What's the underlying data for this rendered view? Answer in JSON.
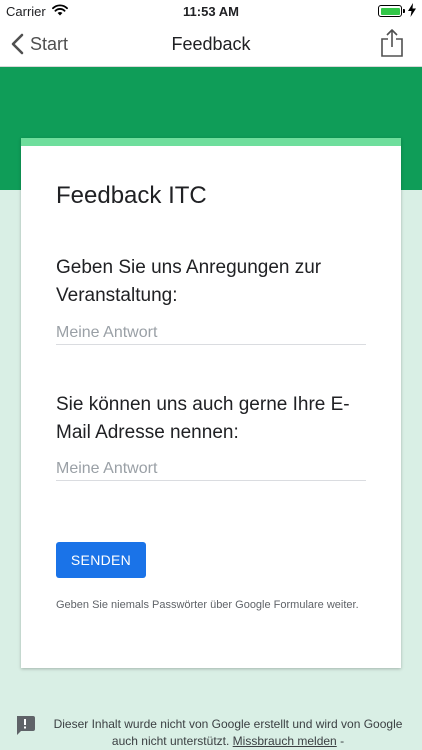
{
  "status_bar": {
    "carrier": "Carrier",
    "time": "11:53 AM",
    "battery_color": "#33c748"
  },
  "nav": {
    "back_label": "Start",
    "title": "Feedback",
    "share_icon": "share-icon"
  },
  "colors": {
    "header_green": "#0f9d58",
    "accent_green": "#6ede9c",
    "page_background": "#d9efe5",
    "button_blue": "#1a73e8"
  },
  "form": {
    "title": "Feedback ITC",
    "questions": [
      {
        "label": "Geben Sie uns Anregungen zur Veranstaltung:",
        "placeholder": "Meine Antwort"
      },
      {
        "label": "Sie können uns auch gerne Ihre E-Mail Adresse nennen:",
        "placeholder": "Meine Antwort"
      }
    ],
    "submit_label": "SENDEN",
    "password_note": "Geben Sie niemals Passwörter über Google Formulare weiter."
  },
  "footer": {
    "disclaimer": "Dieser Inhalt wurde nicht von Google erstellt und wird von Google auch nicht unterstützt.",
    "abuse_link": "Missbrauch melden",
    "separator": "-"
  }
}
